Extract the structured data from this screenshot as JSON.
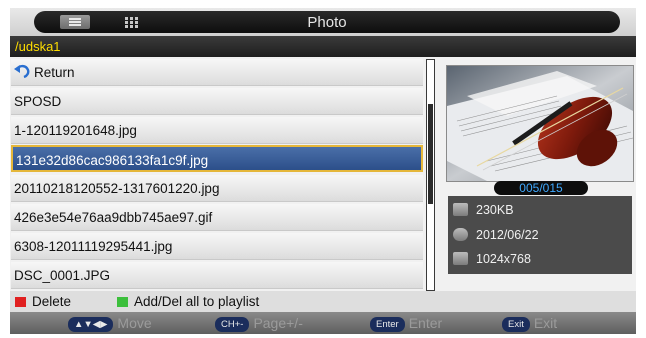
{
  "header": {
    "title": "Photo",
    "path": "/udska1"
  },
  "file_list": {
    "items": [
      {
        "label": "Return",
        "icon": "return-arrow-icon"
      },
      {
        "label": "SPOSD"
      },
      {
        "label": "1-120119201648.jpg"
      },
      {
        "label": "131e32d86cac986133fa1c9f.jpg",
        "selected": true
      },
      {
        "label": "20110218120552-1317601220.jpg"
      },
      {
        "label": "426e3e54e76aa9dbb745ae97.gif"
      },
      {
        "label": "6308-12011119295441.jpg"
      },
      {
        "label": "DSC_0001.JPG"
      }
    ]
  },
  "preview": {
    "image": "violin-on-sheet-music",
    "counter": "005/015",
    "info": {
      "size": "230KB",
      "date": "2012/06/22",
      "resolution": "1024x768"
    }
  },
  "keys": {
    "red_label": "Delete",
    "green_label": "Add/Del all to playlist",
    "red_color": "#e02020",
    "green_color": "#3cbf3c"
  },
  "nav": {
    "move_btn": "▲▼◀▶",
    "move_label": "Move",
    "page_btn": "CH+-",
    "page_label": "Page+/-",
    "enter_btn": "Enter",
    "enter_label": "Enter",
    "exit_btn": "Exit",
    "exit_label": "Exit"
  },
  "colors": {
    "path_text": "#ffde00",
    "selection": "#3a5e98",
    "selection_border": "#e5b73a",
    "counter_text": "#3fa9ff"
  }
}
